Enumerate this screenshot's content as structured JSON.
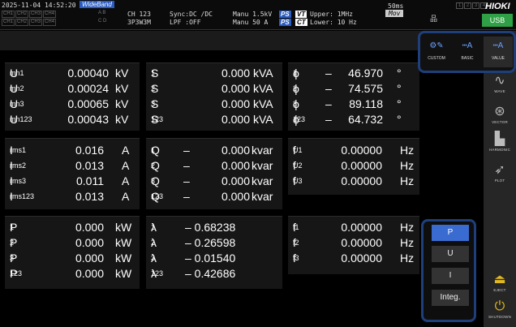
{
  "status": {
    "datetime": "2025-11-04 14:52:20",
    "wideband": "WideBand",
    "channels_top": [
      "CH1",
      "CH2",
      "CH3",
      "CH4"
    ],
    "channels_bottom": [
      "CH1",
      "CH2",
      "CH3",
      "CH4"
    ],
    "ab": "A B",
    "cd": "C D",
    "ch": "CH 123",
    "wiring": "3P3W3M",
    "sync": "Sync:DC /DC",
    "lpf": "LPF :OFF",
    "manu_v": "Manu 1.5kV",
    "manu_a": "Manu  50 A",
    "ps": "PS",
    "vt": "VT",
    "ct": "CT",
    "upper": "Upper:  1MHz",
    "lower": "Lower: 10 Hz",
    "rate": "50ms",
    "mov": "Mov",
    "nums": [
      "1",
      "2",
      "3",
      "4"
    ],
    "logo": "HIOKI",
    "usb": "USB"
  },
  "panels": {
    "voltage": [
      {
        "s": "U",
        "sub": "mn1",
        "v": "0.00040",
        "u": "kV"
      },
      {
        "s": "U",
        "sub": "mn2",
        "v": "0.00024",
        "u": "kV"
      },
      {
        "s": "U",
        "sub": "mn3",
        "v": "0.00065",
        "u": "kV"
      },
      {
        "s": "U",
        "sub": "mn123",
        "v": "0.00043",
        "u": "kV"
      }
    ],
    "apparent": [
      {
        "s": "S",
        "sub": "1",
        "v": "0.000",
        "u": "kVA"
      },
      {
        "s": "S",
        "sub": "2",
        "v": "0.000",
        "u": "kVA"
      },
      {
        "s": "S",
        "sub": "3",
        "v": "0.000",
        "u": "kVA"
      },
      {
        "s": "S",
        "sub": "123",
        "v": "0.000",
        "u": "kVA"
      }
    ],
    "phase": [
      {
        "s": "ϕ",
        "sub": "1",
        "sign": "–",
        "v": "46.970",
        "u": "°"
      },
      {
        "s": "ϕ",
        "sub": "2",
        "sign": "–",
        "v": "74.575",
        "u": "°"
      },
      {
        "s": "ϕ",
        "sub": "3",
        "sign": "–",
        "v": "89.118",
        "u": "°"
      },
      {
        "s": "ϕ",
        "sub": "123",
        "sign": "–",
        "v": "64.732",
        "u": "°"
      }
    ],
    "current": [
      {
        "s": "I",
        "sub": "rms1",
        "v": "0.016",
        "u": "A"
      },
      {
        "s": "I",
        "sub": "rms2",
        "v": "0.013",
        "u": "A"
      },
      {
        "s": "I",
        "sub": "rms3",
        "v": "0.011",
        "u": "A"
      },
      {
        "s": "I",
        "sub": "rms123",
        "v": "0.013",
        "u": "A"
      }
    ],
    "reactive": [
      {
        "s": "Q",
        "sub": "1",
        "sign": "–",
        "v": "0.000",
        "u": "kvar"
      },
      {
        "s": "Q",
        "sub": "2",
        "sign": "–",
        "v": "0.000",
        "u": "kvar"
      },
      {
        "s": "Q",
        "sub": "3",
        "sign": "–",
        "v": "0.000",
        "u": "kvar"
      },
      {
        "s": "Q",
        "sub": "123",
        "sign": "–",
        "v": "0.000",
        "u": "kvar"
      }
    ],
    "freq_u": [
      {
        "s": "f",
        "sub": "U1",
        "v": "0.00000",
        "u": "Hz"
      },
      {
        "s": "f",
        "sub": "U2",
        "v": "0.00000",
        "u": "Hz"
      },
      {
        "s": "f",
        "sub": "U3",
        "v": "0.00000",
        "u": "Hz"
      }
    ],
    "power": [
      {
        "s": "P",
        "sub": "1",
        "v": "0.000",
        "u": "kW"
      },
      {
        "s": "P",
        "sub": "2",
        "v": "0.000",
        "u": "kW"
      },
      {
        "s": "P",
        "sub": "3",
        "v": "0.000",
        "u": "kW"
      },
      {
        "s": "P",
        "sub": "123",
        "v": "0.000",
        "u": "kW"
      }
    ],
    "pf": [
      {
        "s": "λ",
        "sub": "1",
        "v": "– 0.68238"
      },
      {
        "s": "λ",
        "sub": "2",
        "v": "– 0.26598"
      },
      {
        "s": "λ",
        "sub": "3",
        "v": "– 0.01540"
      },
      {
        "s": "λ",
        "sub": "123",
        "v": "– 0.42686"
      }
    ],
    "freq_i": [
      {
        "s": "f",
        "sub": "I1",
        "v": "0.00000",
        "u": "Hz"
      },
      {
        "s": "f",
        "sub": "I2",
        "v": "0.00000",
        "u": "Hz"
      },
      {
        "s": "f",
        "sub": "I3",
        "v": "0.00000",
        "u": "Hz"
      }
    ]
  },
  "modes": [
    {
      "label": "CUSTOM",
      "icon": "custom-icon"
    },
    {
      "label": "BASIC",
      "icon": "basic-icon"
    },
    {
      "label": "VALUE",
      "icon": "value-icon"
    }
  ],
  "sidebar": [
    {
      "label": "WAVE",
      "icon": "wave-icon",
      "glyph": "∿"
    },
    {
      "label": "VECTOR",
      "icon": "vector-icon",
      "glyph": "⊛"
    },
    {
      "label": "HARMONIC",
      "icon": "harmonic-icon",
      "glyph": "▙"
    },
    {
      "label": "PLOT",
      "icon": "plot-icon",
      "glyph": "➶"
    },
    {
      "label": "EJECT",
      "icon": "eject-icon",
      "glyph": "⏏"
    },
    {
      "label": "SHUTDOWN",
      "icon": "shutdown-icon",
      "glyph": "⏻"
    }
  ],
  "selector": [
    "P",
    "U",
    "I",
    "Integ."
  ],
  "colors": {
    "accent": "#3a6bd0",
    "usb": "#2fa045"
  }
}
